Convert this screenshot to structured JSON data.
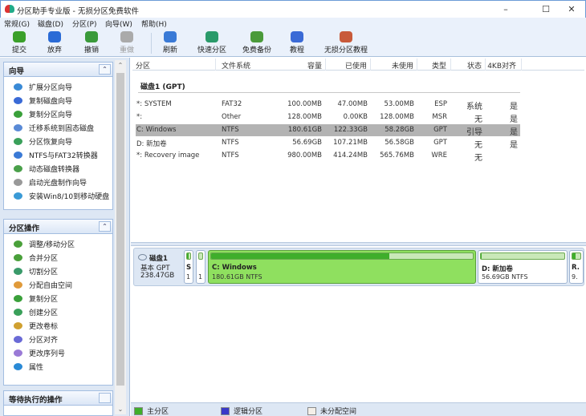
{
  "window": {
    "title": "分区助手专业版 - 无损分区免费软件",
    "minimize": "–",
    "maximize": "☐",
    "close": "✕"
  },
  "menu": [
    "常规(G)",
    "磁盘(D)",
    "分区(P)",
    "向导(W)",
    "帮助(H)"
  ],
  "toolbar": [
    {
      "label": "提交",
      "icon": "check-icon",
      "color": "#3aa02a",
      "disabled": false
    },
    {
      "label": "放弃",
      "icon": "discard-icon",
      "color": "#2a6bd6",
      "disabled": false
    },
    {
      "label": "撤销",
      "icon": "undo-icon",
      "color": "#3a9a3a",
      "disabled": false
    },
    {
      "label": "重做",
      "icon": "redo-icon",
      "color": "#aaaaaa",
      "disabled": true
    },
    {
      "label": "刷新",
      "icon": "refresh-icon",
      "color": "#3a7ad6",
      "disabled": false
    },
    {
      "label": "快速分区",
      "icon": "quick-partition-icon",
      "color": "#2a9a6a",
      "disabled": false
    },
    {
      "label": "免费备份",
      "icon": "backup-icon",
      "color": "#4a9a3a",
      "disabled": false
    },
    {
      "label": "教程",
      "icon": "tutorial-icon",
      "color": "#3a6ad6",
      "disabled": false
    },
    {
      "label": "无损分区教程",
      "icon": "lossless-tutorial-icon",
      "color": "#c85a3a",
      "disabled": false
    }
  ],
  "wizard_panel": {
    "title": "向导",
    "collapse": "⌃",
    "items": [
      {
        "label": "扩展分区向导",
        "color": "#3a8ad6"
      },
      {
        "label": "复制磁盘向导",
        "color": "#3a6ad6"
      },
      {
        "label": "复制分区向导",
        "color": "#3aa03a"
      },
      {
        "label": "迁移系统到固态磁盘",
        "color": "#5a8ad6"
      },
      {
        "label": "分区恢复向导",
        "color": "#3aa05a"
      },
      {
        "label": "NTFS与FAT32转换器",
        "color": "#3a7ad6"
      },
      {
        "label": "动态磁盘转换器",
        "color": "#4aa04a"
      },
      {
        "label": "启动光盘制作向导",
        "color": "#999999"
      },
      {
        "label": "安装Win8/10到移动硬盘",
        "color": "#3a9ad6"
      }
    ]
  },
  "ops_panel": {
    "title": "分区操作",
    "collapse": "⌃",
    "items": [
      {
        "label": "调整/移动分区",
        "color": "#4aa03a"
      },
      {
        "label": "合并分区",
        "color": "#4aa03a"
      },
      {
        "label": "切割分区",
        "color": "#3a9a6a"
      },
      {
        "label": "分配自由空间",
        "color": "#e09a3a"
      },
      {
        "label": "复制分区",
        "color": "#3aa03a"
      },
      {
        "label": "创建分区",
        "color": "#3aa05a"
      },
      {
        "label": "更改卷标",
        "color": "#d0a030"
      },
      {
        "label": "分区对齐",
        "color": "#6a6ad6"
      },
      {
        "label": "更改序列号",
        "color": "#9a7ad6"
      },
      {
        "label": "属性",
        "color": "#2a8ad6"
      }
    ]
  },
  "pending_panel": {
    "title": "等待执行的操作"
  },
  "columns": [
    "分区",
    "文件系统",
    "容量",
    "已使用",
    "未使用",
    "类型",
    "状态",
    "4KB对齐"
  ],
  "disk_heading": "磁盘1 (GPT)",
  "partitions": [
    [
      "*: SYSTEM",
      "FAT32",
      "100.00MB",
      "47.00MB",
      "53.00MB",
      "ESP",
      "系统",
      "是"
    ],
    [
      "*:",
      "Other",
      "128.00MB",
      "0.00KB",
      "128.00MB",
      "MSR",
      "无",
      "是"
    ],
    [
      "C: Windows",
      "NTFS",
      "180.61GB",
      "122.33GB",
      "58.28GB",
      "GPT",
      "引导",
      "是"
    ],
    [
      "D: 新加卷",
      "NTFS",
      "56.69GB",
      "107.21MB",
      "56.58GB",
      "GPT",
      "无",
      "是"
    ],
    [
      "*: Recovery image",
      "NTFS",
      "980.00MB",
      "414.24MB",
      "565.76MB",
      "WRE",
      "无",
      ""
    ]
  ],
  "selected_row": 2,
  "disk_map": {
    "disk": {
      "name": "磁盘1",
      "type": "基本 GPT",
      "size": "238.47GB"
    },
    "blocks": [
      {
        "name": "S",
        "size": "1",
        "used": 0.47
      },
      {
        "name": "",
        "size": "1",
        "used": 0
      },
      {
        "name": "C: Windows",
        "size": "180.61GB NTFS",
        "used": 0.68,
        "selected": true
      },
      {
        "name": "D: 新加卷",
        "size": "56.69GB NTFS",
        "used": 0.002
      },
      {
        "name": "R.",
        "size": "9.",
        "used": 0.42
      }
    ]
  },
  "legend": [
    {
      "label": "主分区",
      "color": "#3fae2b"
    },
    {
      "label": "逻辑分区",
      "color": "#3a3ac8"
    },
    {
      "label": "未分配空间",
      "color": "#f4efe8"
    }
  ]
}
